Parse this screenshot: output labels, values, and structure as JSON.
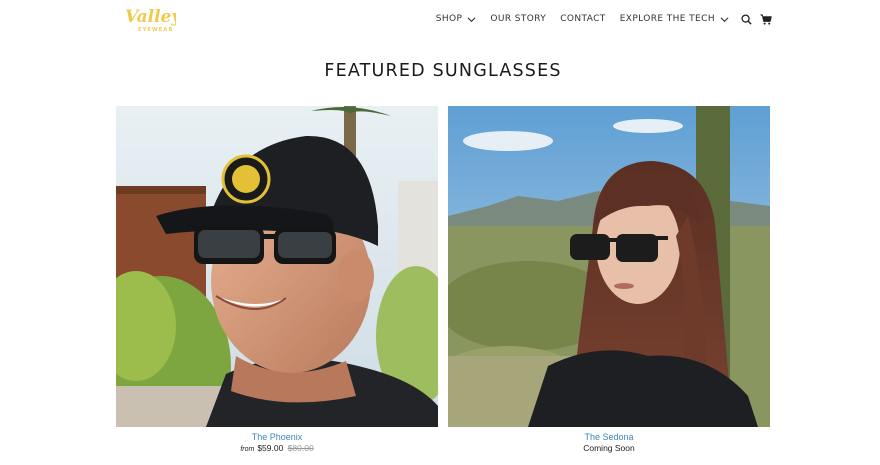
{
  "brand": {
    "name": "Valley",
    "tagline": "EYEWEAR",
    "color": "#f2c94c"
  },
  "nav": {
    "items": [
      {
        "label": "SHOP",
        "has_dropdown": true
      },
      {
        "label": "OUR STORY",
        "has_dropdown": false
      },
      {
        "label": "CONTACT",
        "has_dropdown": false
      },
      {
        "label": "EXPLORE THE TECH",
        "has_dropdown": true
      }
    ],
    "icons": [
      "search-icon",
      "cart-icon"
    ]
  },
  "section": {
    "title": "FEATURED SUNGLASSES"
  },
  "products": [
    {
      "name": "The Phoenix",
      "price_prefix": "from",
      "price": "$59.00",
      "compare_price": "$80.00",
      "image": "man-in-black-cap-wearing-sunglasses"
    },
    {
      "name": "The Sedona",
      "status": "Coming Soon",
      "image": "woman-wearing-sunglasses-desert"
    }
  ],
  "colors": {
    "link": "#3d86b7",
    "text": "#222222",
    "strike": "#999999"
  }
}
